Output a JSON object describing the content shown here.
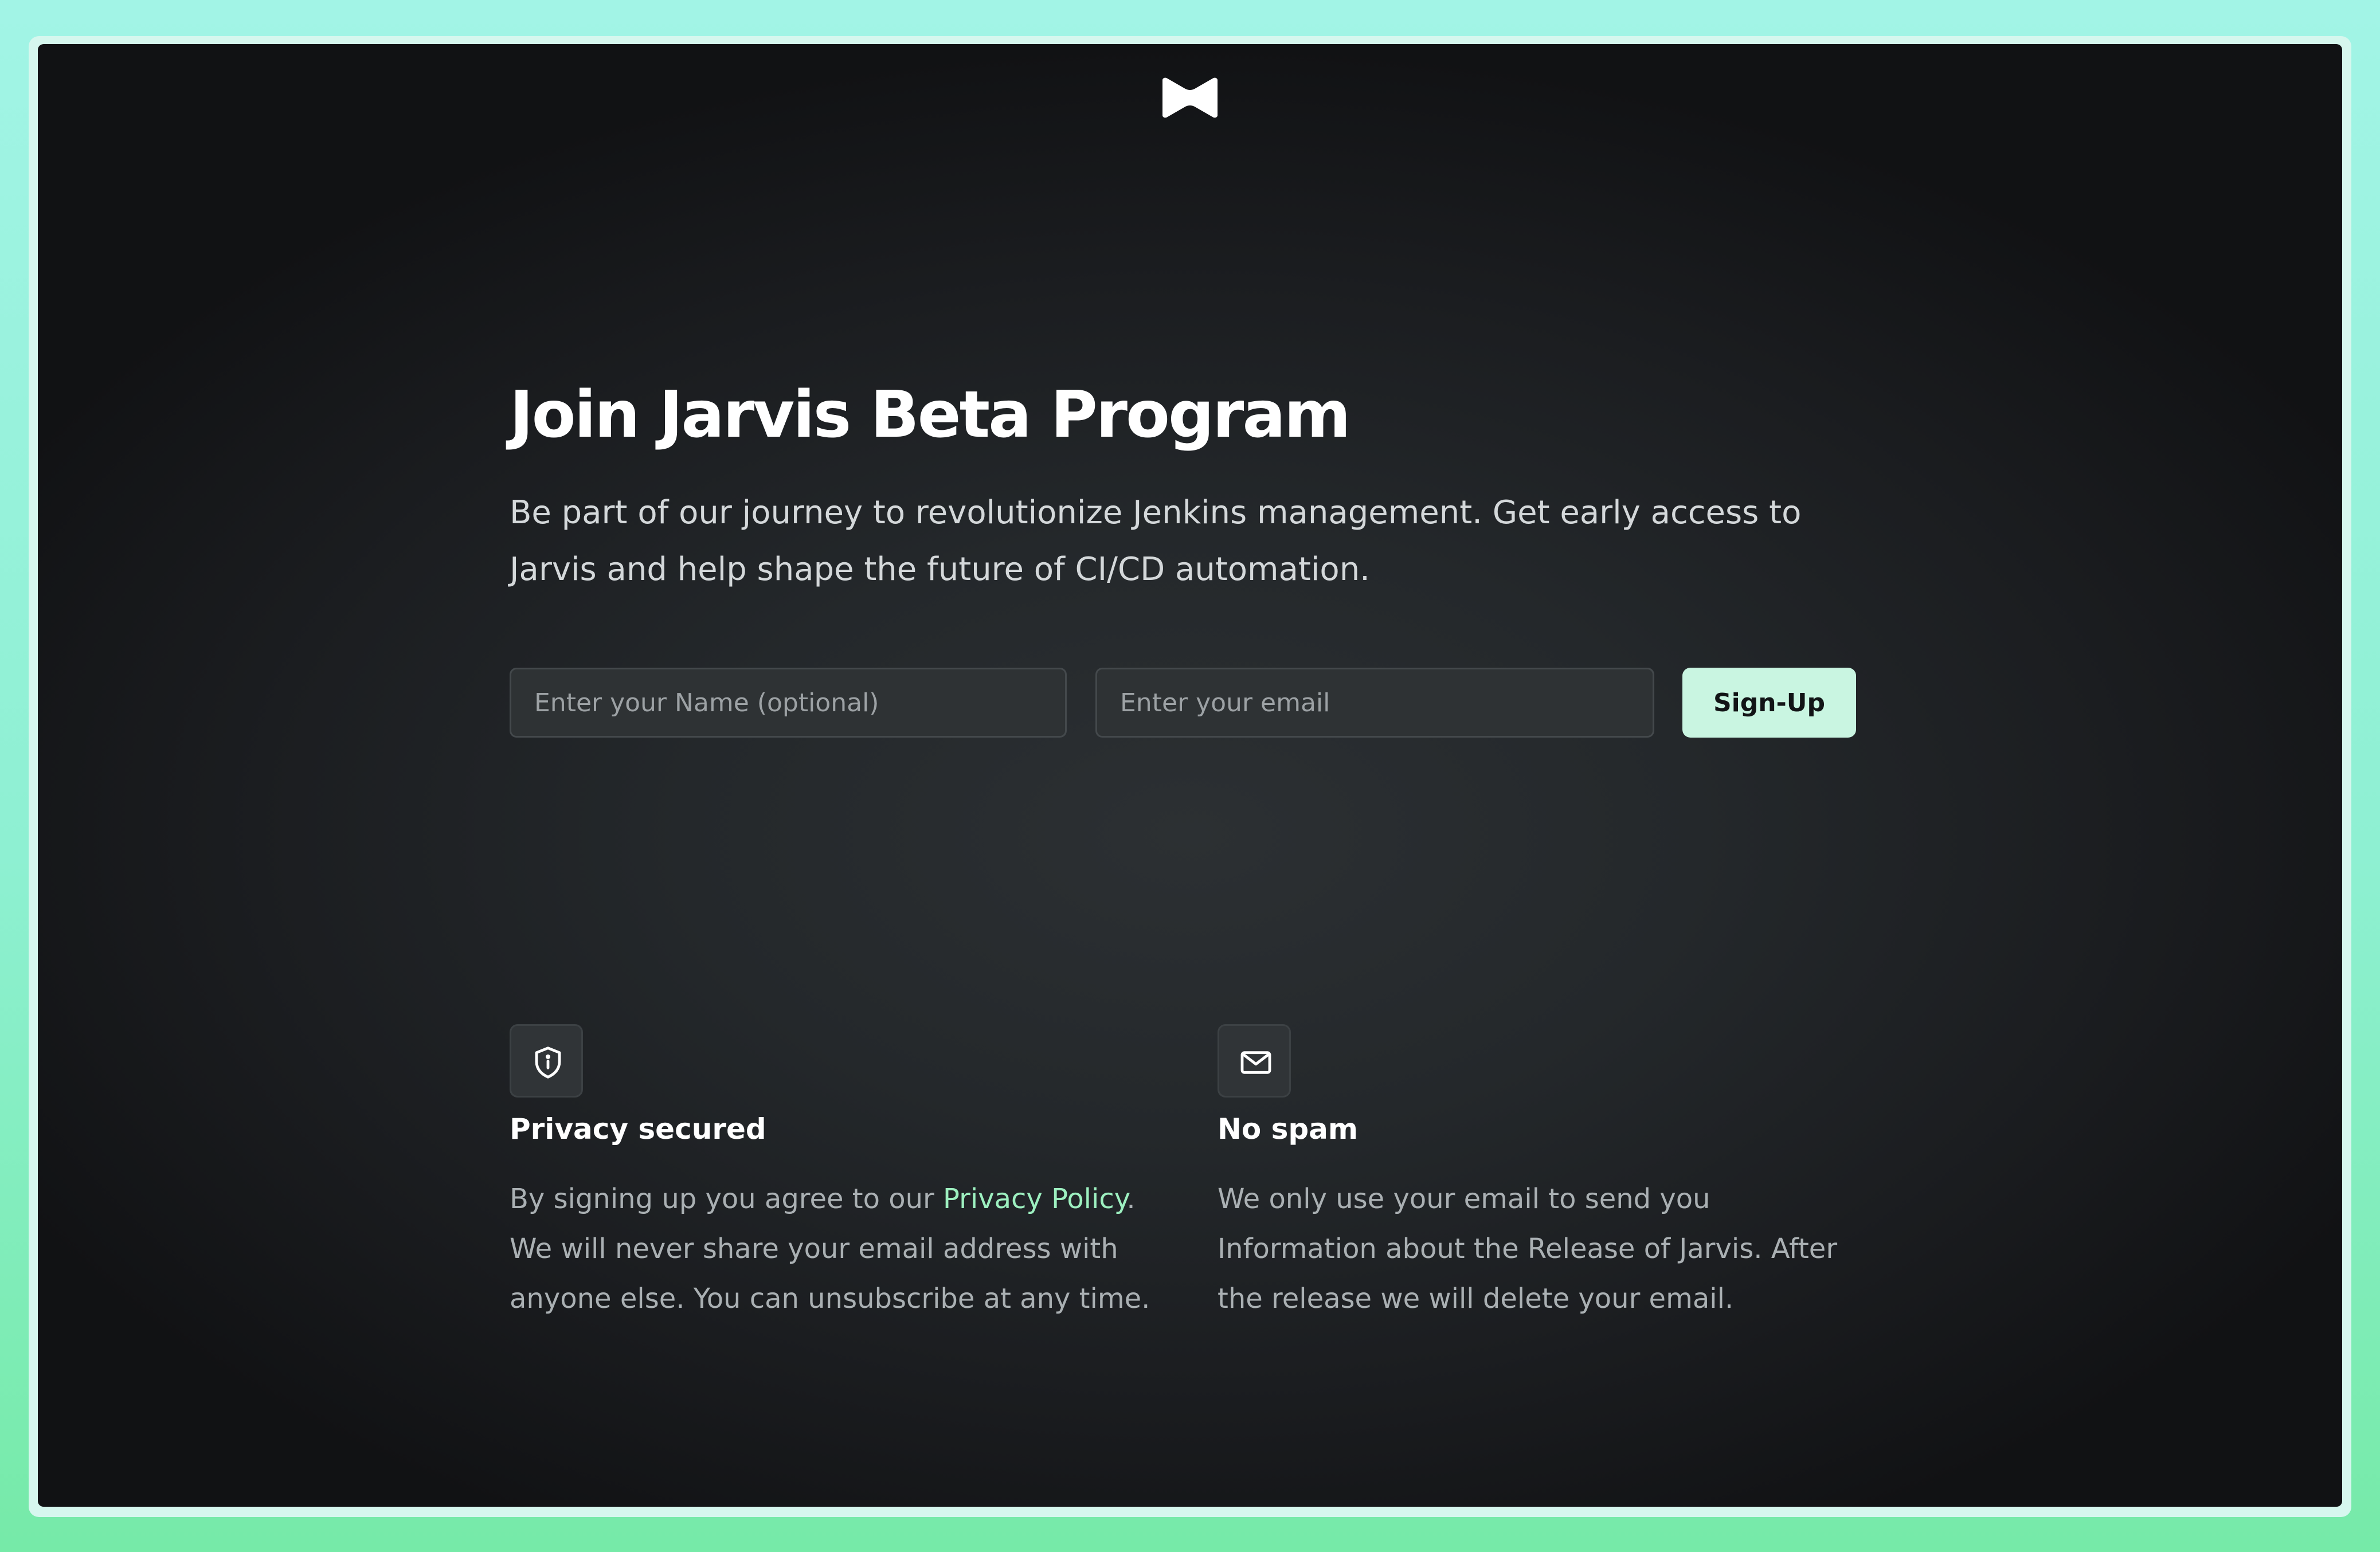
{
  "brand": {
    "logo_icon": "bowtie-logo-icon"
  },
  "hero": {
    "title": "Join Jarvis Beta Program",
    "subtitle": "Be part of our journey to revolutionize Jenkins management. Get early access to Jarvis and help shape the future of CI/CD automation."
  },
  "form": {
    "name_placeholder": "Enter your Name (optional)",
    "name_value": "",
    "email_placeholder": "Enter your email",
    "email_value": "",
    "signup_label": "Sign-Up"
  },
  "features": {
    "privacy": {
      "icon": "shield-info-icon",
      "title": "Privacy secured",
      "text_before_link": "By signing up you agree to our ",
      "link_label": "Privacy Policy",
      "text_after_link": ". We will never share your email address with anyone else. You can unsubscribe at any time."
    },
    "spam": {
      "icon": "mail-icon",
      "title": "No spam",
      "text": "We only use your email to send you Information about the Release of Jarvis. After the release we will delete your email."
    }
  },
  "colors": {
    "accent": "#c9f5e1",
    "link": "#9df0c0",
    "background_dark": "#1b1d20",
    "frame_gradient_top": "#a2f4e6",
    "frame_gradient_bottom": "#76eaa8"
  }
}
